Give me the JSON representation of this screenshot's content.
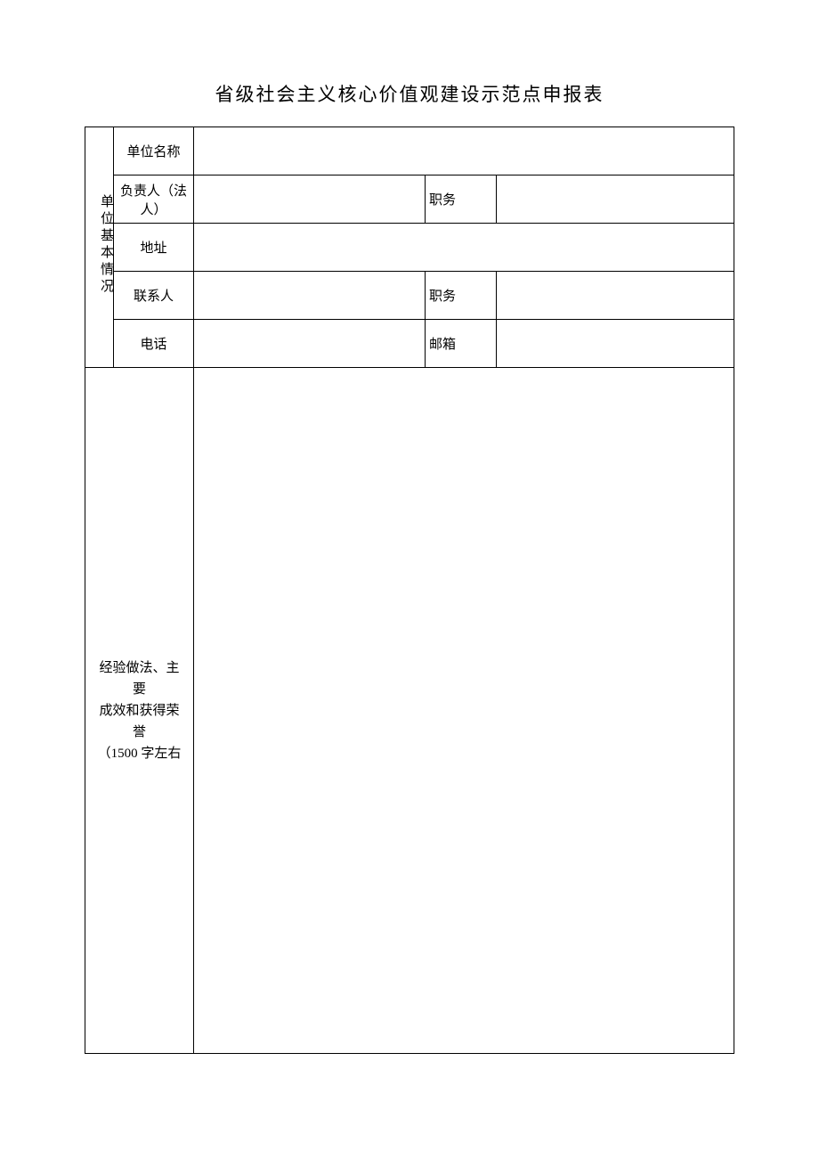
{
  "title": "省级社会主义核心价值观建设示范点申报表",
  "section1": {
    "header": "单位基本情况",
    "rows": {
      "unitName": {
        "label": "单位名称",
        "value": ""
      },
      "principal": {
        "label": "负责人（法人）",
        "value": "",
        "label2": "职务",
        "value2": ""
      },
      "address": {
        "label": "地址",
        "value": ""
      },
      "contact": {
        "label": "联系人",
        "value": "",
        "label2": "职务",
        "value2": ""
      },
      "phone": {
        "label": "电话",
        "value": "",
        "label2": "邮箱",
        "value2": ""
      }
    }
  },
  "section2": {
    "label_line1": "经验做法、主要",
    "label_line2": "成效和获得荣誉",
    "label_line3": "（1500 字左右",
    "value": ""
  }
}
